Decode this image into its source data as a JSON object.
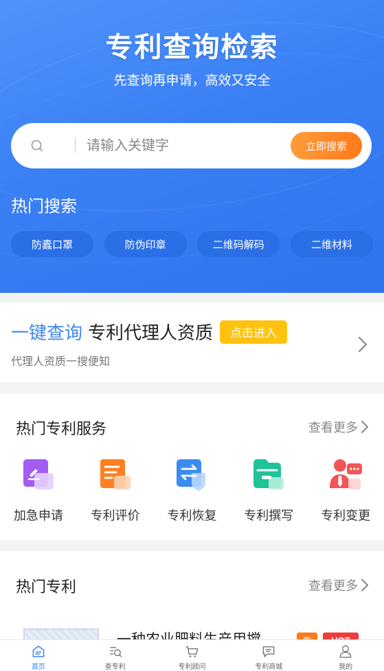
{
  "hero": {
    "title": "专利查询检索",
    "subtitle": "先查询再申请，高效又安全"
  },
  "search": {
    "placeholder": "请输入关键字",
    "button_label": "立即搜索",
    "icon": "search-icon"
  },
  "hot_search": {
    "title": "热门搜索",
    "tags": [
      "防蠹口罩",
      "防伪印章",
      "二维码解码",
      "二维材料"
    ]
  },
  "quick_query": {
    "highlight": "一键查询",
    "title": "专利代理人资质",
    "button_label": "点击进入",
    "subtitle": "代理人资质一搜便知",
    "icon": "chevron-right-icon"
  },
  "services": {
    "title": "热门专利服务",
    "more_label": "查看更多",
    "items": [
      {
        "label": "加急申请",
        "icon": "urgent-apply-icon",
        "color": "#a25cf0"
      },
      {
        "label": "专利评价",
        "icon": "patent-evaluation-icon",
        "color": "#ff7f22"
      },
      {
        "label": "专利恢复",
        "icon": "patent-restore-icon",
        "color": "#3a8cf2"
      },
      {
        "label": "专利撰写",
        "icon": "patent-writing-icon",
        "color": "#1ec39a"
      },
      {
        "label": "专利变更",
        "icon": "patent-change-icon",
        "color": "#f25555"
      }
    ]
  },
  "patents": {
    "title": "热门专利",
    "more_label": "查看更多",
    "items": [
      {
        "title": "一种农业肥料生产用搅…",
        "badge_discount": "惠",
        "badge_hot": "HOT"
      }
    ]
  },
  "tabbar": {
    "items": [
      {
        "label": "首页",
        "icon": "home-icon",
        "active": true
      },
      {
        "label": "查专利",
        "icon": "patent-search-icon",
        "active": false
      },
      {
        "label": "专利顾问",
        "icon": "cart-icon",
        "active": false
      },
      {
        "label": "专利商城",
        "icon": "message-icon",
        "active": false
      },
      {
        "label": "我的",
        "icon": "user-icon",
        "active": false
      }
    ]
  },
  "colors": {
    "primary": "#3d86f5",
    "accent_orange": "#ff7a1a",
    "accent_yellow": "#ffc20e",
    "hot_red": "#f23b3b"
  }
}
